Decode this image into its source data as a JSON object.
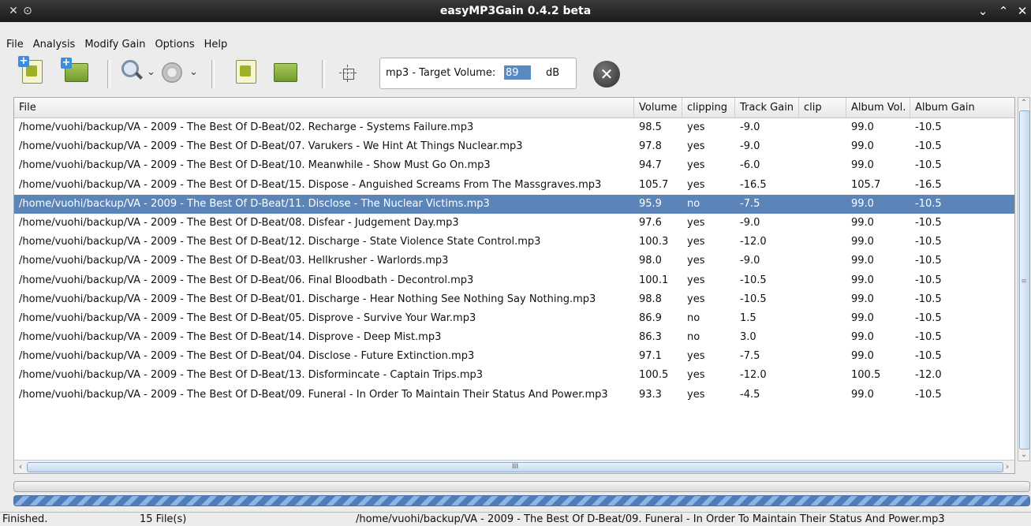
{
  "window": {
    "title": "easyMP3Gain 0.4.2 beta"
  },
  "menu": [
    "File",
    "Analysis",
    "Modify Gain",
    "Options",
    "Help"
  ],
  "toolbar": {
    "target_label": "mp3 - Target Volume:",
    "target_value": "89",
    "target_unit": "dB"
  },
  "table": {
    "columns": [
      "File",
      "Volume",
      "clipping",
      "Track Gain",
      "clip",
      "Album Vol.",
      "Album Gain"
    ],
    "rows": [
      [
        "/home/vuohi/backup/VA - 2009 - The Best Of D-Beat/02. Recharge - Systems Failure.mp3",
        "98.5",
        "yes",
        "-9.0",
        "",
        "99.0",
        "-10.5"
      ],
      [
        "/home/vuohi/backup/VA - 2009 - The Best Of D-Beat/07. Varukers - We Hint At Things Nuclear.mp3",
        "97.8",
        "yes",
        "-9.0",
        "",
        "99.0",
        "-10.5"
      ],
      [
        "/home/vuohi/backup/VA - 2009 - The Best Of D-Beat/10. Meanwhile - Show Must Go On.mp3",
        "94.7",
        "yes",
        "-6.0",
        "",
        "99.0",
        "-10.5"
      ],
      [
        "/home/vuohi/backup/VA - 2009 - The Best Of D-Beat/15. Dispose - Anguished Screams From The Massgraves.mp3",
        "105.7",
        "yes",
        "-16.5",
        "",
        "105.7",
        "-16.5"
      ],
      [
        "/home/vuohi/backup/VA - 2009 - The Best Of D-Beat/11. Disclose - The Nuclear Victims.mp3",
        "95.9",
        "no",
        "-7.5",
        "",
        "99.0",
        "-10.5"
      ],
      [
        "/home/vuohi/backup/VA - 2009 - The Best Of D-Beat/08. Disfear - Judgement Day.mp3",
        "97.6",
        "yes",
        "-9.0",
        "",
        "99.0",
        "-10.5"
      ],
      [
        "/home/vuohi/backup/VA - 2009 - The Best Of D-Beat/12. Discharge - State Violence State Control.mp3",
        "100.3",
        "yes",
        "-12.0",
        "",
        "99.0",
        "-10.5"
      ],
      [
        "/home/vuohi/backup/VA - 2009 - The Best Of D-Beat/03. Hellkrusher - Warlords.mp3",
        "98.0",
        "yes",
        "-9.0",
        "",
        "99.0",
        "-10.5"
      ],
      [
        "/home/vuohi/backup/VA - 2009 - The Best Of D-Beat/06. Final Bloodbath - Decontrol.mp3",
        "100.1",
        "yes",
        "-10.5",
        "",
        "99.0",
        "-10.5"
      ],
      [
        "/home/vuohi/backup/VA - 2009 - The Best Of D-Beat/01. Discharge - Hear Nothing See Nothing Say Nothing.mp3",
        "98.8",
        "yes",
        "-10.5",
        "",
        "99.0",
        "-10.5"
      ],
      [
        "/home/vuohi/backup/VA - 2009 - The Best Of D-Beat/05. Disprove - Survive Your War.mp3",
        "86.9",
        "no",
        "1.5",
        "",
        "99.0",
        "-10.5"
      ],
      [
        "/home/vuohi/backup/VA - 2009 - The Best Of D-Beat/14. Disprove - Deep Mist.mp3",
        "86.3",
        "no",
        "3.0",
        "",
        "99.0",
        "-10.5"
      ],
      [
        "/home/vuohi/backup/VA - 2009 - The Best Of D-Beat/04. Disclose - Future Extinction.mp3",
        "97.1",
        "yes",
        "-7.5",
        "",
        "99.0",
        "-10.5"
      ],
      [
        "/home/vuohi/backup/VA - 2009 - The Best Of D-Beat/13. Disformincate - Captain Trips.mp3",
        "100.5",
        "yes",
        "-12.0",
        "",
        "100.5",
        "-12.0"
      ],
      [
        "/home/vuohi/backup/VA - 2009 - The Best Of D-Beat/09. Funeral - In Order To Maintain Their Status And Power.mp3",
        "93.3",
        "yes",
        "-4.5",
        "",
        "99.0",
        "-10.5"
      ]
    ],
    "selected_row": 4
  },
  "status": {
    "state": "Finished.",
    "count": "15 File(s)",
    "current_file": "/home/vuohi/backup/VA - 2009 - The Best Of D-Beat/09. Funeral - In Order To Maintain Their Status And Power.mp3"
  },
  "colors": {
    "selection": "#5b84b8",
    "titlebar": "#222222",
    "progress": "#4f7dbb"
  }
}
